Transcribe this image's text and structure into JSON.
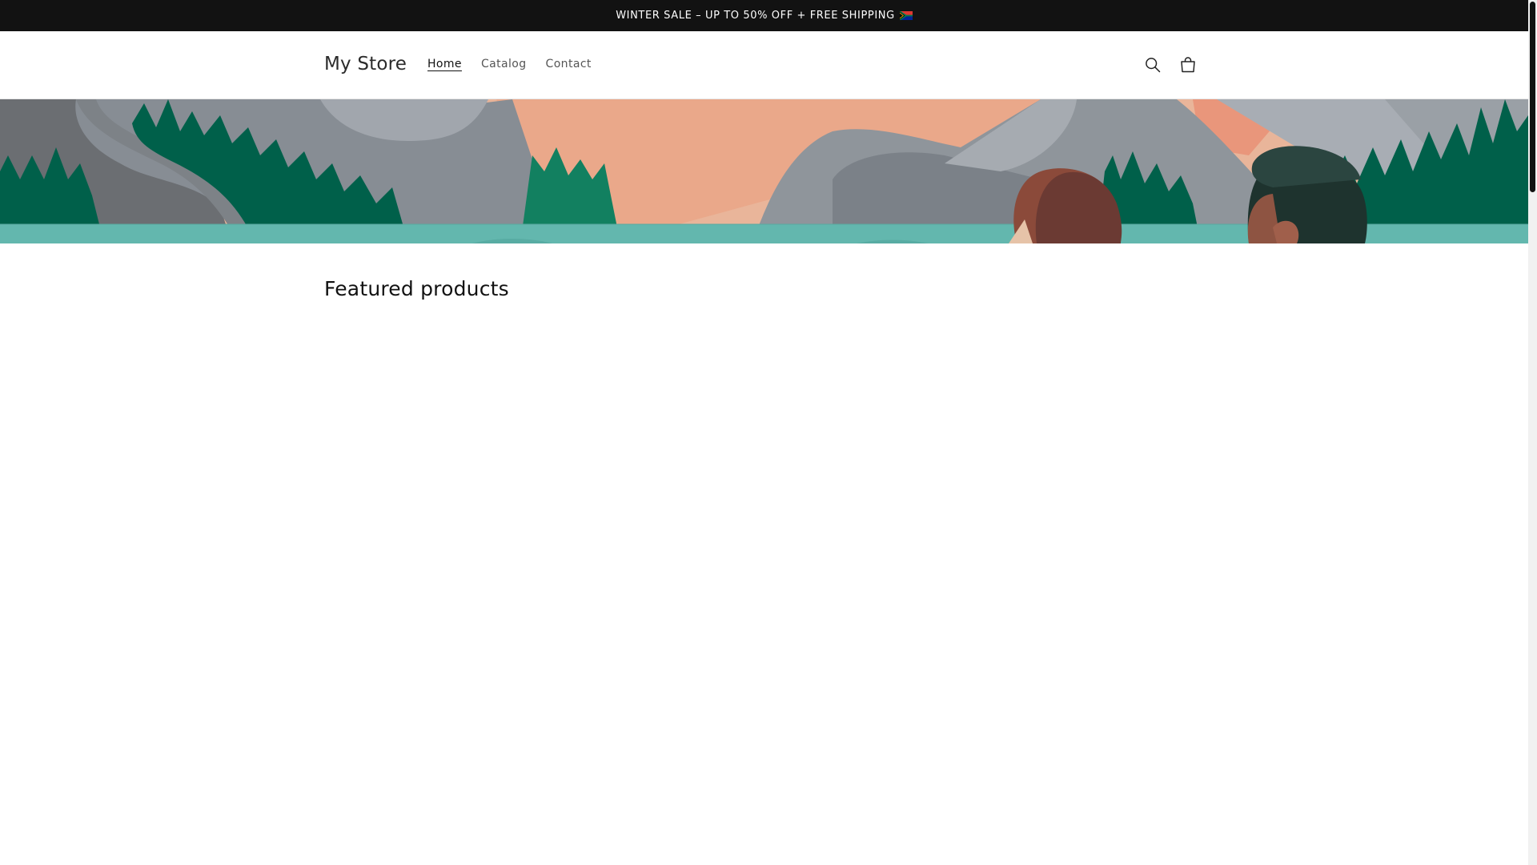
{
  "announcement": {
    "text": "WINTER SALE – UP TO 50% OFF + FREE SHIPPING",
    "flag_icon": "south-africa-flag-icon"
  },
  "header": {
    "logo": "My Store",
    "nav": [
      {
        "label": "Home",
        "active": true
      },
      {
        "label": "Catalog",
        "active": false
      },
      {
        "label": "Contact",
        "active": false
      }
    ],
    "icons": [
      "search-icon",
      "cart-icon"
    ]
  },
  "featured": {
    "title": "Featured products"
  },
  "colors": {
    "announcement_bg": "#121212",
    "forest_green": "#00604a",
    "teal_water": "#63b7ae",
    "peach": "#e9b59a",
    "coral": "#e9967b",
    "grey_mountain": "#878d94"
  }
}
